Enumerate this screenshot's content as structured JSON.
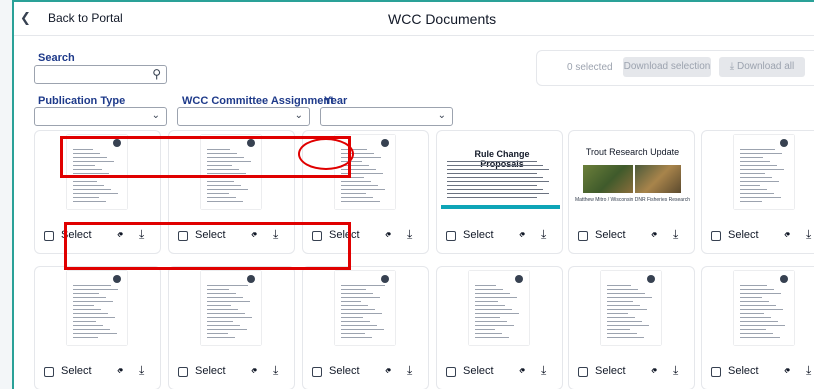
{
  "header": {
    "back_label": "Back to Portal",
    "back_icon": "chevron-left-icon",
    "title": "WCC Documents"
  },
  "filters": {
    "search_label": "Search",
    "search_value": "",
    "search_icon": "search-icon",
    "publication_type_label": "Publication Type",
    "publication_type_value": "",
    "committee_label": "WCC Committee Assignment",
    "committee_value": "",
    "year_label": "Year",
    "year_value": ""
  },
  "actions": {
    "selected_count": "0 selected",
    "download_selection": "Download selection",
    "download_all": "Download all",
    "download_icon": "download-icon"
  },
  "cards": [
    {
      "thumb": "document",
      "select_label": "Select"
    },
    {
      "thumb": "document",
      "select_label": "Select"
    },
    {
      "thumb": "document",
      "select_label": "Select"
    },
    {
      "thumb": "rule-change",
      "select_label": "Select",
      "thumb_title": "Rule Change Proposals"
    },
    {
      "thumb": "trout",
      "select_label": "Select",
      "thumb_title": "Trout Research Update",
      "thumb_subtitle": "Matthew Mitro / Wisconsin DNR Fisheries Research"
    },
    {
      "thumb": "document",
      "select_label": "Select"
    },
    {
      "thumb": "document",
      "select_label": "Select"
    },
    {
      "thumb": "document",
      "select_label": "Select"
    },
    {
      "thumb": "document",
      "select_label": "Select"
    },
    {
      "thumb": "document",
      "select_label": "Select"
    },
    {
      "thumb": "document",
      "select_label": "Select"
    },
    {
      "thumb": "document",
      "select_label": "Select"
    }
  ],
  "colors": {
    "accent": "#2aa198",
    "label": "#1e3a8a",
    "annotation": "#e00000"
  }
}
